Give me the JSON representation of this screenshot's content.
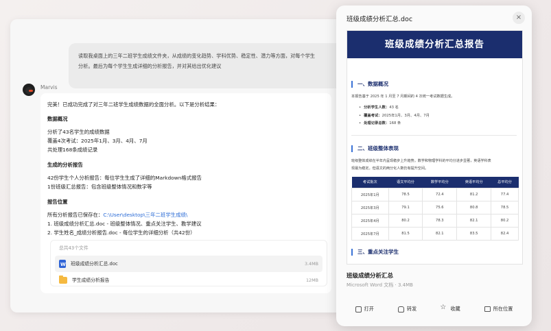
{
  "user_message": {
    "line1": "读取我桌面上的三年二班学生成绩文件夹，从成绩的变化趋势、学科优势、稳定性、潜力等方面，对每个学生",
    "line2": "分析。最后为每个学生生成详细的分析报告，并对其给出优化建议"
  },
  "agent": {
    "name": "Marvis",
    "intro": "完美！已成功完成了对三年二班学生成绩数据的全面分析。以下是分析结果：",
    "section1_title": "数据概况",
    "s1_l1": "分析了43名学生的成绩数据",
    "s1_l2": "覆盖4次考试：2025年1月、3月、4月、7月",
    "s1_l3": "共处理168条成绩记录",
    "section2_title": "生成的分析报告",
    "s2_l1": "42份学生个人分析报告：每位学生生成了详细的Markdown格式报告",
    "s2_l2": "1份班级汇总报告：包含班级整体情况和数字等",
    "section3_title": "报告位置",
    "s3_prefix": "所有分析报告已保存在：",
    "s3_path": "C:\\User\\desktop\\三年二班学生成绩\\",
    "s3_i1": "1. 班级成绩分析汇总.doc - 班级整体情况、重点关注学生、教学建议",
    "s3_i2": "2. 学生姓名_成绩分析报告.doc - 每位学生的详细分析（共42份）"
  },
  "files": {
    "count_label": "总共43个文件",
    "items": [
      {
        "name": "班级成绩分析汇总.doc",
        "size": "3.4MB",
        "icon": "word-doc-icon"
      },
      {
        "name": "学生成绩分析报告",
        "size": "12MB",
        "icon": "folder-icon"
      }
    ]
  },
  "preview": {
    "title": "班级成绩分析汇总.doc",
    "close": "×",
    "file_name": "班级成绩分析汇总",
    "file_meta": "Microsoft Word 文档 · 3.4MB",
    "actions": {
      "open": "打开",
      "share": "转发",
      "favorite": "收藏",
      "location": "所在位置"
    }
  },
  "doc": {
    "banner": "班级成绩分析汇总报告",
    "h1": "一、数据概况",
    "p1": "本报告基于 2025 年 1 月至 7 月期间的 4 次统一考试数据生成。",
    "list": [
      {
        "k": "分析学生人数：",
        "v": "43 名"
      },
      {
        "k": "覆盖考试：",
        "v": "2025年1月、3月、4月、7月"
      },
      {
        "k": "处理记录总数：",
        "v": "168 条"
      }
    ],
    "h2": "二、班级整体表现",
    "p2a": "班级整体成绩在半年内呈现稳步上升趋势。数学和物理学科的平均分进步显著，英语学科表",
    "p2b": "现最为稳定。但语文的两分化人数仍有提升空间。",
    "table_headers": [
      "考试批次",
      "语文平均分",
      "数学平均分",
      "英语平均分",
      "总平均分"
    ],
    "table_rows": [
      [
        "2025年1月",
        "78.5",
        "72.4",
        "81.2",
        "77.4"
      ],
      [
        "2025年3月",
        "79.1",
        "75.6",
        "80.8",
        "78.5"
      ],
      [
        "2025年4月",
        "80.2",
        "78.3",
        "82.1",
        "80.2"
      ],
      [
        "2025年7月",
        "81.5",
        "82.1",
        "83.5",
        "82.4"
      ]
    ],
    "h3": "三、重点关注学生"
  }
}
